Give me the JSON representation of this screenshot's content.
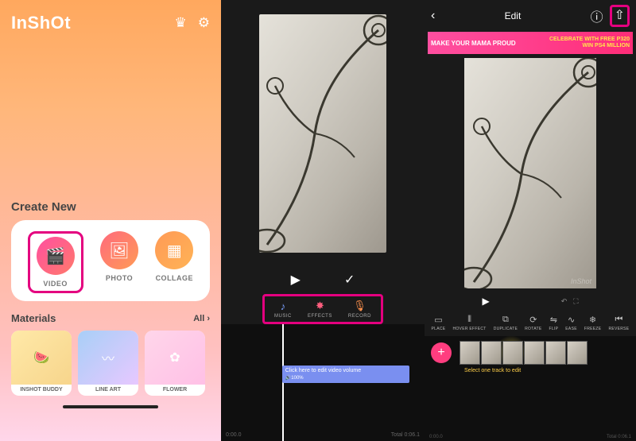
{
  "home": {
    "logo": "InShOt",
    "section_create": "Create New",
    "create": {
      "video": "VIDEO",
      "photo": "PHOTO",
      "collage": "COLLAGE"
    },
    "section_materials": "Materials",
    "materials_all": "All ›",
    "materials": [
      {
        "label": "INSHOT BUDDY"
      },
      {
        "label": "LINE ART"
      },
      {
        "label": "FLOWER"
      }
    ]
  },
  "editorA": {
    "music_tabs": {
      "music": "MUSIC",
      "effects": "EFFECTS",
      "record": "RECORD"
    },
    "timeline": {
      "volume_hint": "Click here to edit video volume",
      "volume_value": "🔊100%",
      "time_start": "0:00.0",
      "time_total": "Total 0:06.1"
    }
  },
  "editorB": {
    "header_title": "Edit",
    "ad": {
      "left": "MAKE YOUR MAMA PROUD",
      "right_l1": "CELEBRATE WITH FREE P320",
      "right_l2": "WIN PS4 MILLION"
    },
    "watermark": "InShot",
    "tools": {
      "place": "PLACE",
      "hover": "HOVER EFFECT",
      "duplicate": "DUPLICATE",
      "rotate": "ROTATE",
      "flip": "FLIP",
      "ease": "EASE",
      "freeze": "FREEZE",
      "reverse": "REVERSE"
    },
    "timeline": {
      "hint": "Select one track to edit",
      "time_start": "0:00.0",
      "time_total": "Total 0:06.1"
    }
  }
}
